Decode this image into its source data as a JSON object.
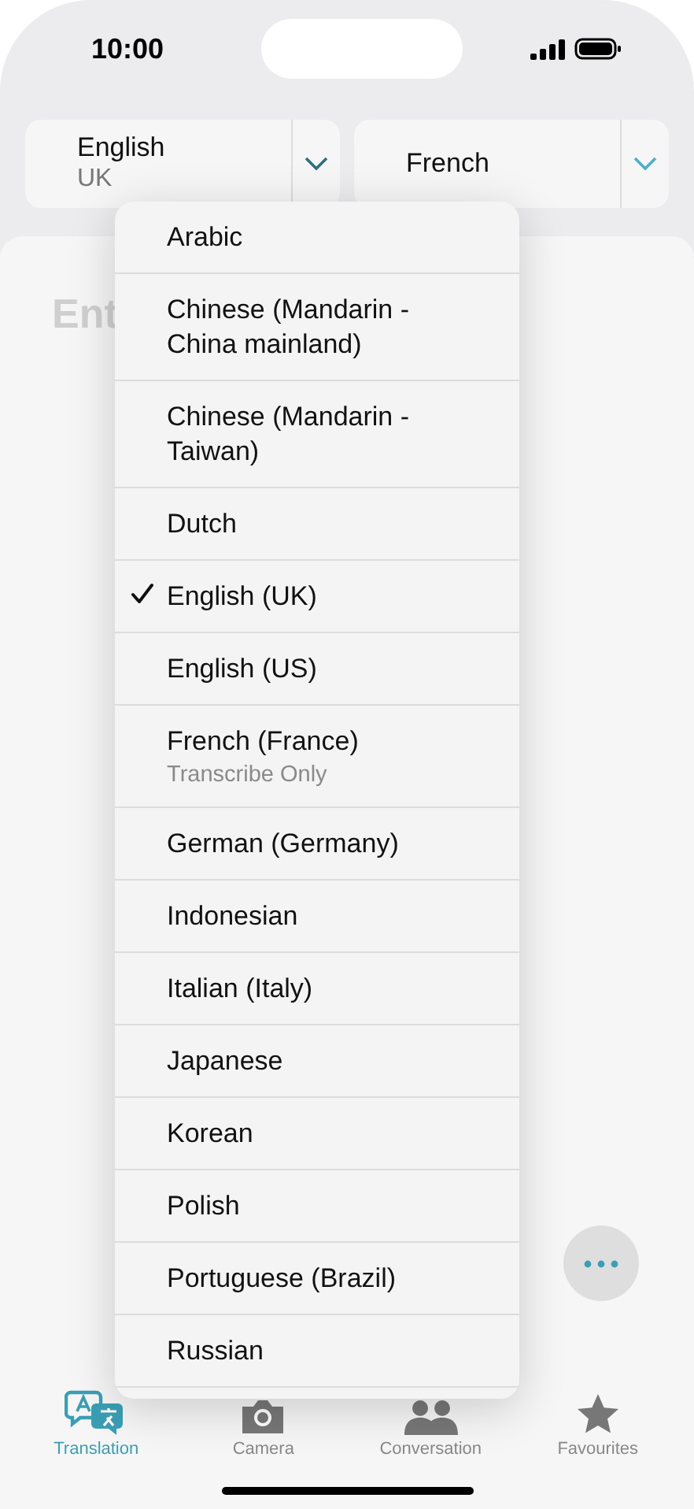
{
  "status_bar": {
    "time": "10:00"
  },
  "language_selectors": [
    {
      "language": "English",
      "region": "UK"
    },
    {
      "language": "French"
    }
  ],
  "input": {
    "placeholder": "Ent"
  },
  "language_menu": {
    "items": [
      {
        "label": "Arabic",
        "selected": false
      },
      {
        "label": "Chinese (Mandarin - China mainland)",
        "selected": false
      },
      {
        "label": "Chinese (Mandarin - Taiwan)",
        "selected": false
      },
      {
        "label": "Dutch",
        "selected": false
      },
      {
        "label": "English (UK)",
        "selected": true
      },
      {
        "label": "English (US)",
        "selected": false
      },
      {
        "label": "French (France)",
        "subtitle": "Transcribe Only",
        "selected": false
      },
      {
        "label": "German (Germany)",
        "selected": false
      },
      {
        "label": "Indonesian",
        "selected": false
      },
      {
        "label": "Italian (Italy)",
        "selected": false
      },
      {
        "label": "Japanese",
        "selected": false
      },
      {
        "label": "Korean",
        "selected": false
      },
      {
        "label": "Polish",
        "selected": false
      },
      {
        "label": "Portuguese (Brazil)",
        "selected": false
      },
      {
        "label": "Russian",
        "selected": false
      }
    ]
  },
  "tabs": [
    {
      "kind": "translation",
      "label": "Translation",
      "selected": true
    },
    {
      "kind": "camera",
      "label": "Camera",
      "selected": false
    },
    {
      "kind": "conversation",
      "label": "Conversation",
      "selected": false
    },
    {
      "kind": "favourites",
      "label": "Favourites",
      "selected": false
    }
  ]
}
